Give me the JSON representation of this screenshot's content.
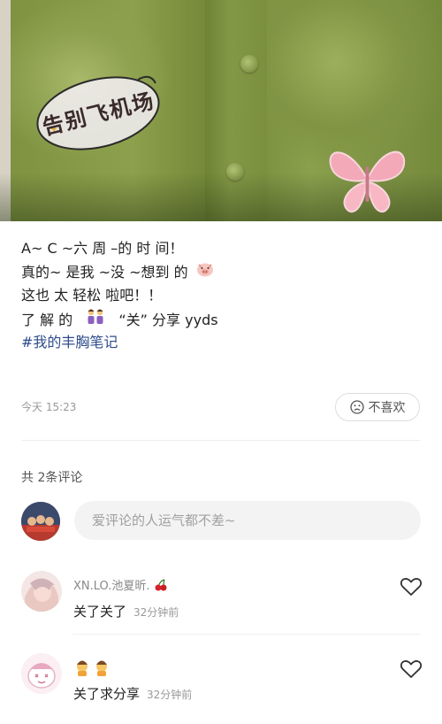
{
  "post": {
    "lines": [
      "A~ C ~六 周 –的 时 间！",
      "真的~ 是我 ~没 ~想到 的",
      "这也 太 轻松 啦吧！！",
      "了 解 的",
      "“关” 分享 yyds"
    ],
    "hashtag": "#我的丰胸笔记",
    "sticker_text": "告别飞机场"
  },
  "meta": {
    "time": "今天 15:23",
    "dislike_label": "不喜欢"
  },
  "comments_section": {
    "count_label": "共 2条评论",
    "input_placeholder": "爱评论的人运气都不差~"
  },
  "comments": [
    {
      "username": "XN.LO.池夏昕.",
      "text": "关了关了",
      "time_ago": "32分钟前"
    },
    {
      "username": "",
      "text": "关了求分享",
      "time_ago": "32分钟前"
    }
  ],
  "icons": {
    "pig_emoji": "pig-face-icon",
    "people_emoji": "two-women-icon",
    "cherry_emoji": "cherry-icon",
    "kids_emoji": "kids-icon",
    "dislike": "sad-face-icon",
    "like": "heart-outline-icon"
  },
  "colors": {
    "hashtag": "#2f4c8a",
    "muted": "#999999",
    "input_bg": "#f3f3f3"
  }
}
